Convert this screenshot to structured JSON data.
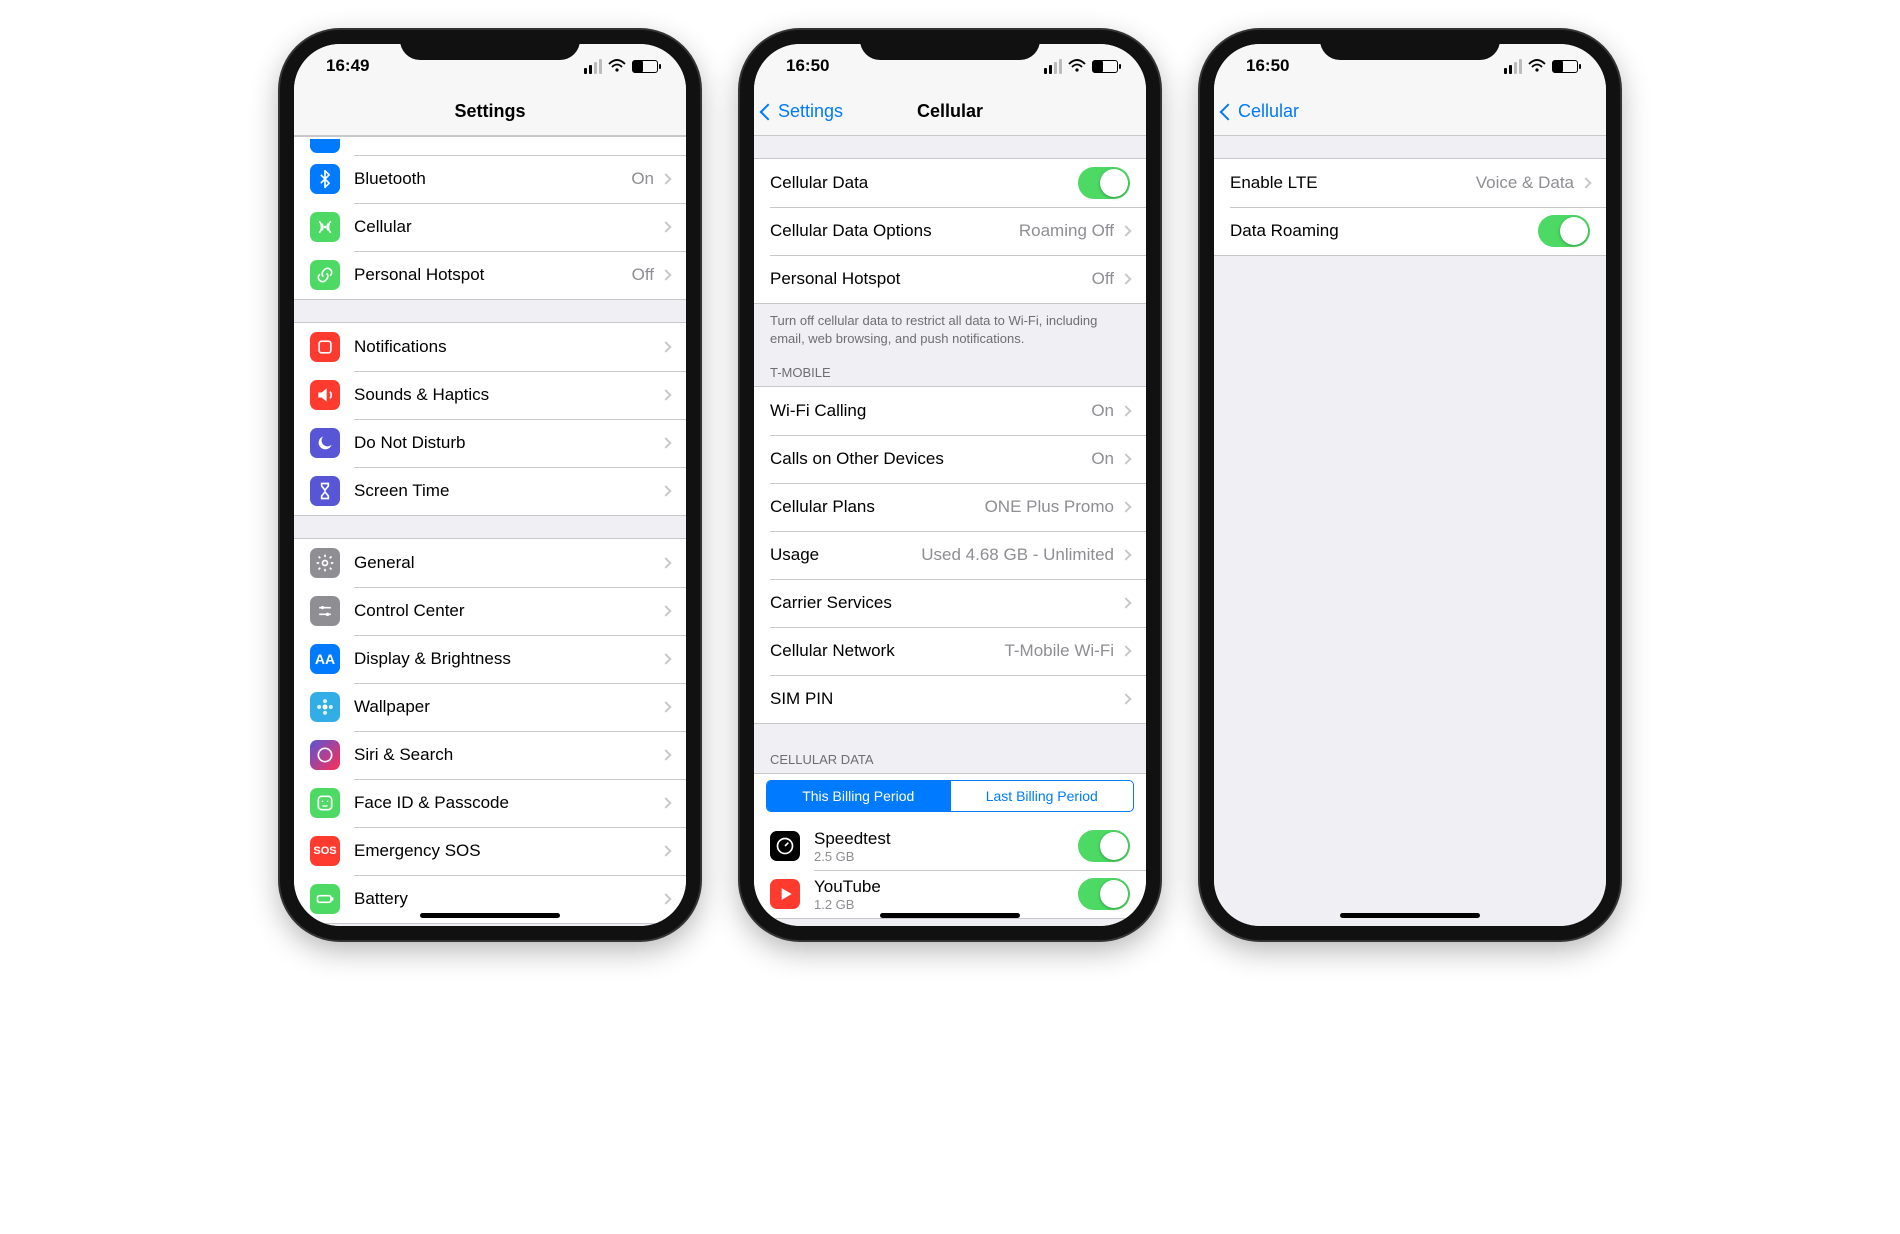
{
  "phone1": {
    "time": "16:49",
    "title": "Settings",
    "groups": [
      {
        "rows": [
          {
            "name": "bluetooth",
            "label": "Bluetooth",
            "detail": "On",
            "iconBg": "bg-blue",
            "iconKind": "bluetooth"
          },
          {
            "name": "cellular",
            "label": "Cellular",
            "iconBg": "bg-green",
            "iconKind": "antenna"
          },
          {
            "name": "hotspot",
            "label": "Personal Hotspot",
            "detail": "Off",
            "iconBg": "bg-green",
            "iconKind": "link"
          }
        ]
      },
      {
        "rows": [
          {
            "name": "notifications",
            "label": "Notifications",
            "iconBg": "bg-red",
            "iconKind": "square"
          },
          {
            "name": "sounds",
            "label": "Sounds & Haptics",
            "iconBg": "bg-red",
            "iconKind": "speaker"
          },
          {
            "name": "dnd",
            "label": "Do Not Disturb",
            "iconBg": "bg-purple",
            "iconKind": "moon"
          },
          {
            "name": "screentime",
            "label": "Screen Time",
            "iconBg": "bg-purple",
            "iconKind": "hourglass"
          }
        ]
      },
      {
        "rows": [
          {
            "name": "general",
            "label": "General",
            "iconBg": "bg-gray",
            "iconKind": "gear"
          },
          {
            "name": "controlcenter",
            "label": "Control Center",
            "iconBg": "bg-gray",
            "iconKind": "sliders"
          },
          {
            "name": "display",
            "label": "Display & Brightness",
            "iconBg": "bg-blue",
            "iconKind": "aa"
          },
          {
            "name": "wallpaper",
            "label": "Wallpaper",
            "iconBg": "bg-teal",
            "iconKind": "flower"
          },
          {
            "name": "siri",
            "label": "Siri & Search",
            "iconBg": "bg-gradient",
            "iconKind": "siri"
          },
          {
            "name": "faceid",
            "label": "Face ID & Passcode",
            "iconBg": "bg-green",
            "iconKind": "face"
          },
          {
            "name": "sos",
            "label": "Emergency SOS",
            "iconBg": "bg-red",
            "iconKind": "sos"
          },
          {
            "name": "battery",
            "label": "Battery",
            "iconBg": "bg-green",
            "iconKind": "battery"
          }
        ]
      }
    ]
  },
  "phone2": {
    "time": "16:50",
    "back": "Settings",
    "title": "Cellular",
    "section1": {
      "rows": [
        {
          "name": "cellular-data",
          "label": "Cellular Data",
          "switch": true
        },
        {
          "name": "cellular-data-options",
          "label": "Cellular Data Options",
          "detail": "Roaming Off",
          "chevron": true
        },
        {
          "name": "personal-hotspot",
          "label": "Personal Hotspot",
          "detail": "Off",
          "chevron": true
        }
      ],
      "footer": "Turn off cellular data to restrict all data to Wi-Fi, including email, web browsing, and push notifications."
    },
    "section2": {
      "header": "T-MOBILE",
      "rows": [
        {
          "name": "wifi-calling",
          "label": "Wi-Fi Calling",
          "detail": "On",
          "chevron": true
        },
        {
          "name": "calls-other",
          "label": "Calls on Other Devices",
          "detail": "On",
          "chevron": true
        },
        {
          "name": "plans",
          "label": "Cellular Plans",
          "detail": "ONE Plus Promo",
          "chevron": true
        },
        {
          "name": "usage",
          "label": "Usage",
          "detail": "Used 4.68 GB - Unlimited",
          "chevron": true
        },
        {
          "name": "carrier-services",
          "label": "Carrier Services",
          "chevron": true
        },
        {
          "name": "cellular-network",
          "label": "Cellular Network",
          "detail": "T-Mobile Wi-Fi",
          "chevron": true
        },
        {
          "name": "sim-pin",
          "label": "SIM PIN",
          "chevron": true
        }
      ]
    },
    "section3": {
      "header": "CELLULAR DATA",
      "segmented": {
        "active": "This Billing Period",
        "inactive": "Last Billing Period"
      },
      "apps": [
        {
          "name": "speedtest",
          "label": "Speedtest",
          "sub": "2.5 GB",
          "iconBg": "bg-black"
        },
        {
          "name": "youtube",
          "label": "YouTube",
          "sub": "1.2 GB",
          "iconBg": "bg-red"
        }
      ]
    }
  },
  "phone3": {
    "time": "16:50",
    "back": "Cellular",
    "rows": [
      {
        "name": "enable-lte",
        "label": "Enable LTE",
        "detail": "Voice & Data",
        "chevron": true
      },
      {
        "name": "data-roaming",
        "label": "Data Roaming",
        "switch": true
      }
    ]
  }
}
